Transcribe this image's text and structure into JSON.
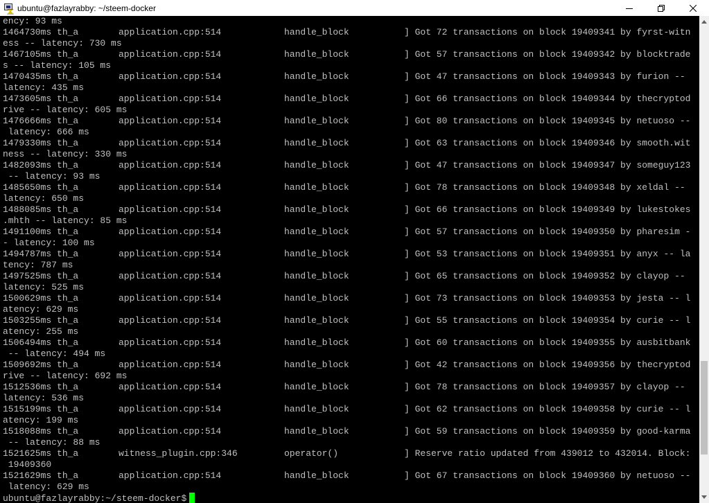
{
  "window": {
    "title": "ubuntu@fazlayrabby: ~/steem-docker",
    "controls": {
      "minimize": "minimize",
      "maximize": "restore",
      "close": "close"
    }
  },
  "terminal": {
    "first_line": "ency: 93 ms",
    "entries": [
      {
        "time": "1464730ms th_a",
        "file": "application.cpp:514",
        "func": "handle_block",
        "msg": "] Got 72 transactions on block 19409341 by fyrst-witn",
        "cont": "ess -- latency: 730 ms"
      },
      {
        "time": "1467105ms th_a",
        "file": "application.cpp:514",
        "func": "handle_block",
        "msg": "] Got 57 transactions on block 19409342 by blocktrade",
        "cont": "s -- latency: 105 ms"
      },
      {
        "time": "1470435ms th_a",
        "file": "application.cpp:514",
        "func": "handle_block",
        "msg": "] Got 47 transactions on block 19409343 by furion --",
        "cont": "latency: 435 ms"
      },
      {
        "time": "1473605ms th_a",
        "file": "application.cpp:514",
        "func": "handle_block",
        "msg": "] Got 66 transactions on block 19409344 by thecryptod",
        "cont": "rive -- latency: 605 ms"
      },
      {
        "time": "1476666ms th_a",
        "file": "application.cpp:514",
        "func": "handle_block",
        "msg": "] Got 80 transactions on block 19409345 by netuoso --",
        "cont": " latency: 666 ms"
      },
      {
        "time": "1479330ms th_a",
        "file": "application.cpp:514",
        "func": "handle_block",
        "msg": "] Got 63 transactions on block 19409346 by smooth.wit",
        "cont": "ness -- latency: 330 ms"
      },
      {
        "time": "1482093ms th_a",
        "file": "application.cpp:514",
        "func": "handle_block",
        "msg": "] Got 47 transactions on block 19409347 by someguy123",
        "cont": " -- latency: 93 ms"
      },
      {
        "time": "1485650ms th_a",
        "file": "application.cpp:514",
        "func": "handle_block",
        "msg": "] Got 78 transactions on block 19409348 by xeldal --",
        "cont": "latency: 650 ms"
      },
      {
        "time": "1488085ms th_a",
        "file": "application.cpp:514",
        "func": "handle_block",
        "msg": "] Got 66 transactions on block 19409349 by lukestokes",
        "cont": ".mhth -- latency: 85 ms"
      },
      {
        "time": "1491100ms th_a",
        "file": "application.cpp:514",
        "func": "handle_block",
        "msg": "] Got 57 transactions on block 19409350 by pharesim -",
        "cont": "- latency: 100 ms"
      },
      {
        "time": "1494787ms th_a",
        "file": "application.cpp:514",
        "func": "handle_block",
        "msg": "] Got 53 transactions on block 19409351 by anyx -- la",
        "cont": "tency: 787 ms"
      },
      {
        "time": "1497525ms th_a",
        "file": "application.cpp:514",
        "func": "handle_block",
        "msg": "] Got 65 transactions on block 19409352 by clayop --",
        "cont": "latency: 525 ms"
      },
      {
        "time": "1500629ms th_a",
        "file": "application.cpp:514",
        "func": "handle_block",
        "msg": "] Got 73 transactions on block 19409353 by jesta -- l",
        "cont": "atency: 629 ms"
      },
      {
        "time": "1503255ms th_a",
        "file": "application.cpp:514",
        "func": "handle_block",
        "msg": "] Got 55 transactions on block 19409354 by curie -- l",
        "cont": "atency: 255 ms"
      },
      {
        "time": "1506494ms th_a",
        "file": "application.cpp:514",
        "func": "handle_block",
        "msg": "] Got 60 transactions on block 19409355 by ausbitbank",
        "cont": " -- latency: 494 ms"
      },
      {
        "time": "1509692ms th_a",
        "file": "application.cpp:514",
        "func": "handle_block",
        "msg": "] Got 42 transactions on block 19409356 by thecryptod",
        "cont": "rive -- latency: 692 ms"
      },
      {
        "time": "1512536ms th_a",
        "file": "application.cpp:514",
        "func": "handle_block",
        "msg": "] Got 78 transactions on block 19409357 by clayop --",
        "cont": "latency: 536 ms"
      },
      {
        "time": "1515199ms th_a",
        "file": "application.cpp:514",
        "func": "handle_block",
        "msg": "] Got 62 transactions on block 19409358 by curie -- l",
        "cont": "atency: 199 ms"
      },
      {
        "time": "1518088ms th_a",
        "file": "application.cpp:514",
        "func": "handle_block",
        "msg": "] Got 59 transactions on block 19409359 by good-karma",
        "cont": " -- latency: 88 ms"
      },
      {
        "time": "1521625ms th_a",
        "file": "witness_plugin.cpp:346",
        "func": "operator()",
        "msg": "] Reserve ratio updated from 439012 to 432014. Block:",
        "cont": " 19409360"
      },
      {
        "time": "1521629ms th_a",
        "file": "application.cpp:514",
        "func": "handle_block",
        "msg": "] Got 67 transactions on block 19409360 by netuoso --",
        "cont": " latency: 629 ms"
      }
    ],
    "prompt": "ubuntu@fazlayrabby:~/steem-docker$"
  },
  "colors": {
    "background": "#000000",
    "text": "#c0c0c0",
    "cursor": "#00ff00",
    "titlebar": "#ffffff"
  },
  "scrollbar": {
    "position": 0.9
  }
}
